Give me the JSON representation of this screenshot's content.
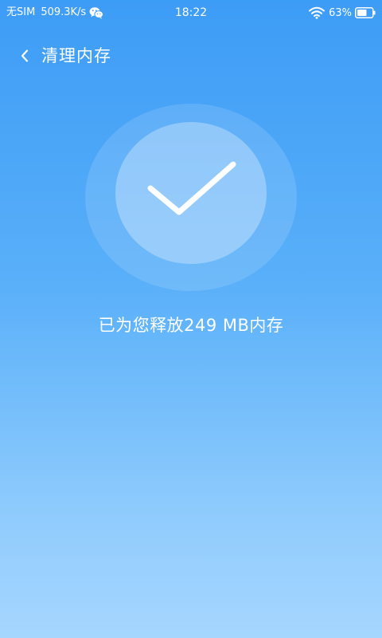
{
  "status_bar": {
    "carrier": "无SIM",
    "net_speed": "509.3K/s",
    "time": "18:22",
    "battery": "63%",
    "icons": [
      "wechat-icon",
      "wifi-icon",
      "battery-icon"
    ]
  },
  "header": {
    "back_icon": "chevron-left-icon",
    "title": "清理内存"
  },
  "result": {
    "icon": "check-icon",
    "message": "已为您释放249 MB内存"
  },
  "colors": {
    "background_top": "#3d9cf6",
    "background_bottom": "#a6d6fe",
    "text": "#ffffff"
  }
}
